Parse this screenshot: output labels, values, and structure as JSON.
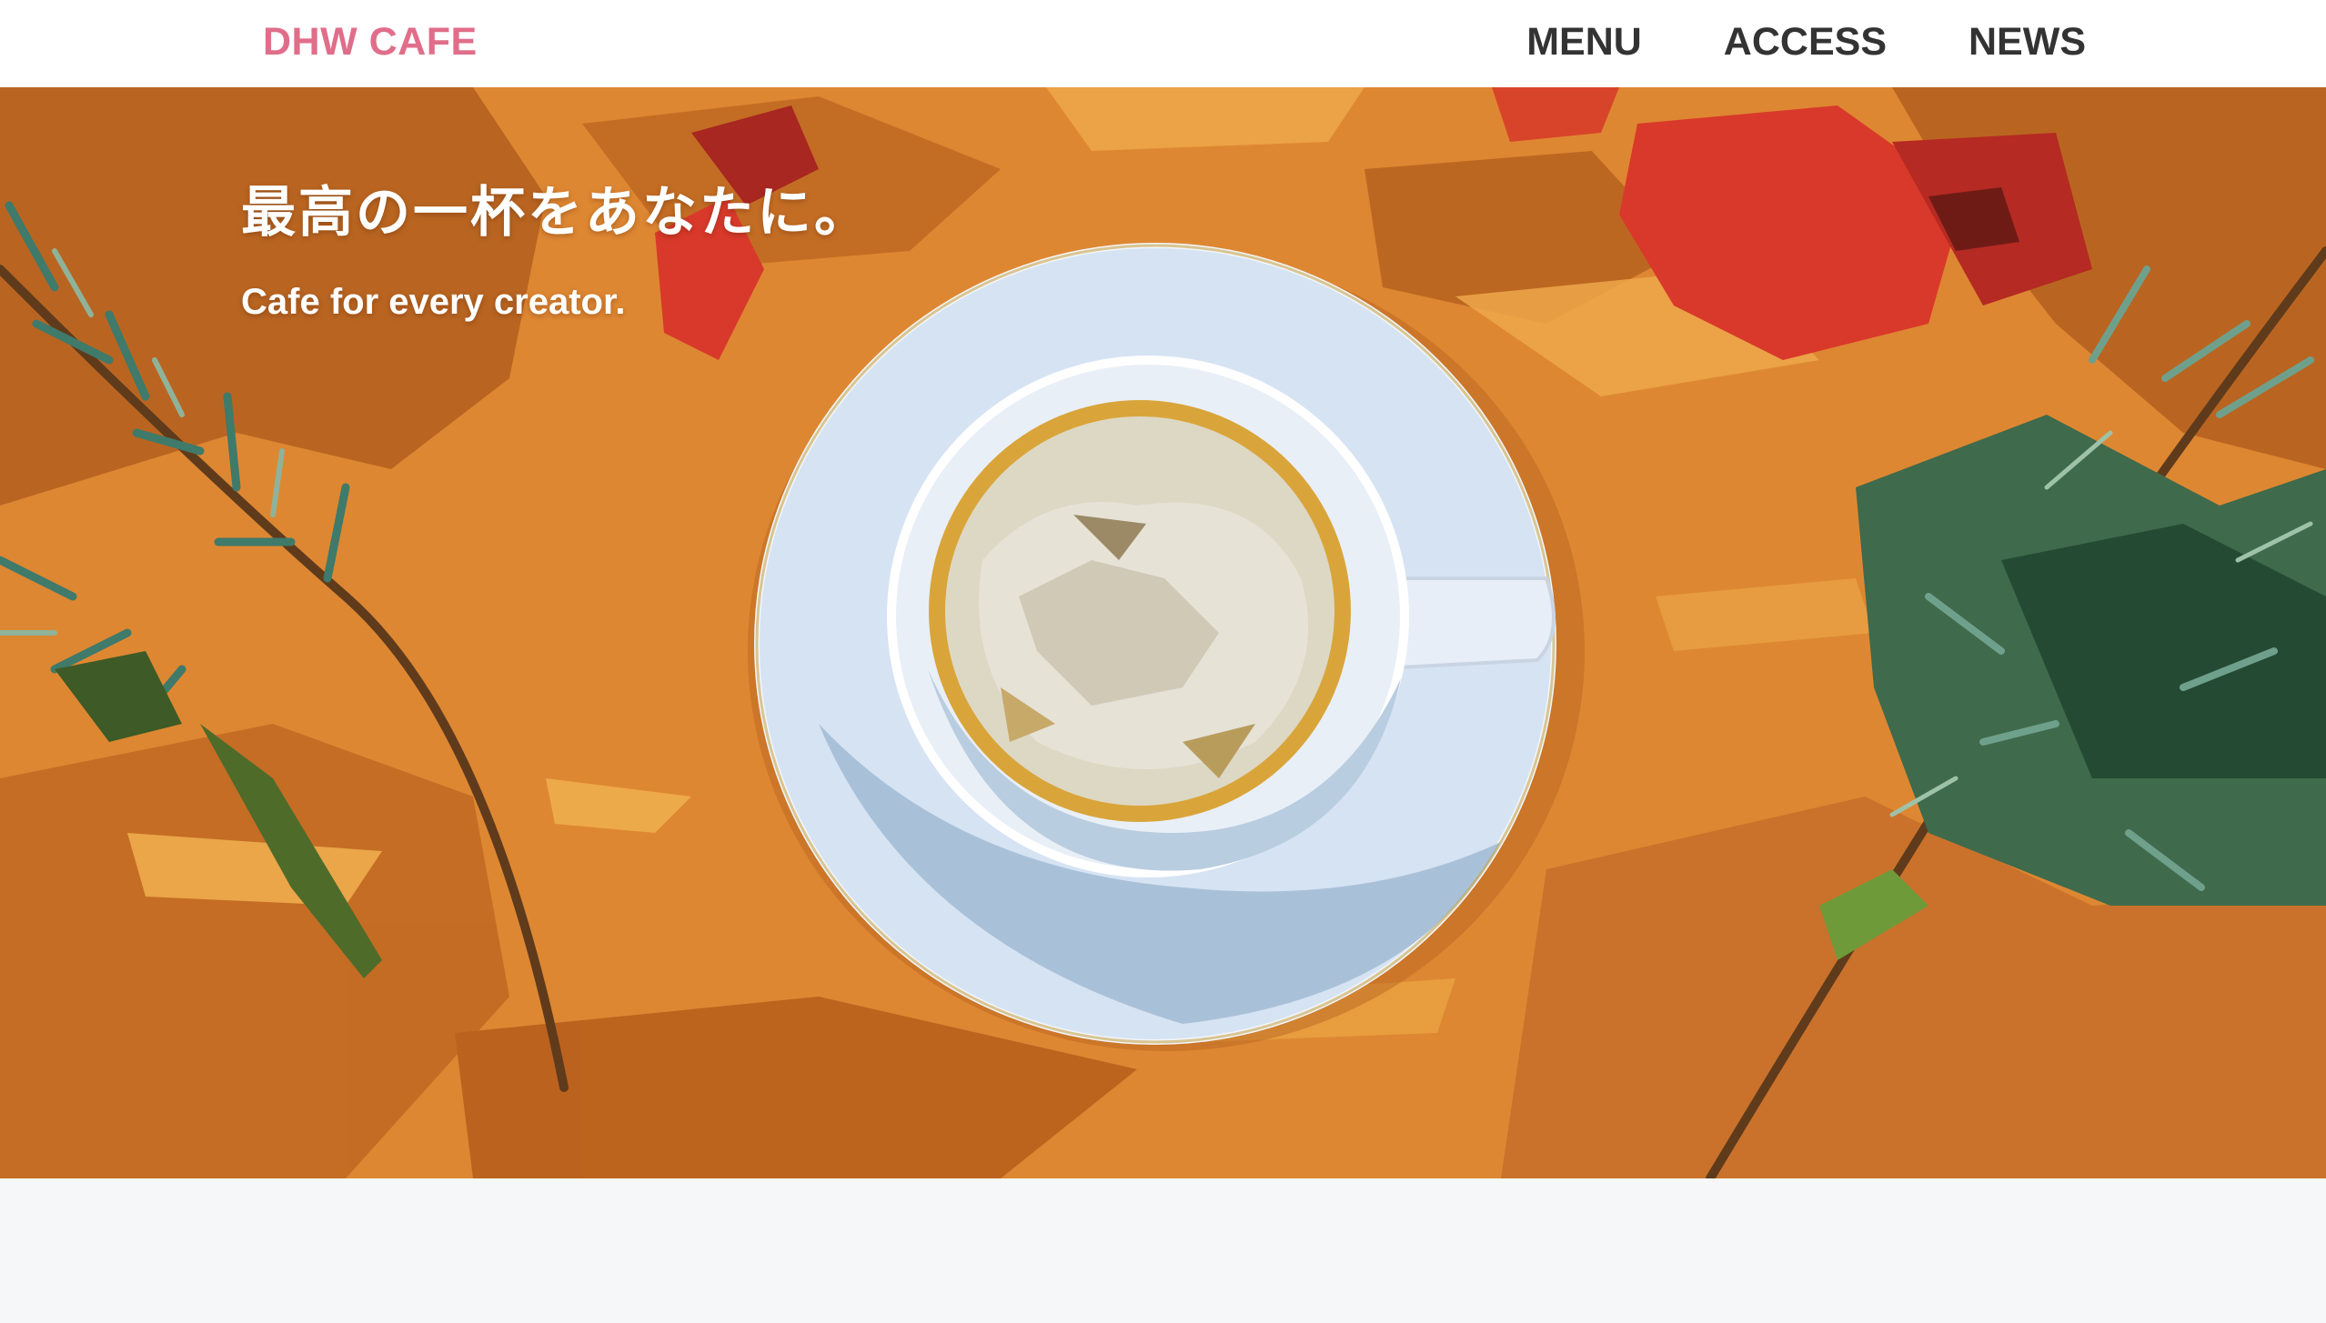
{
  "header": {
    "logo": "DHW CAFE",
    "nav": [
      {
        "label": "MENU"
      },
      {
        "label": "ACCESS"
      },
      {
        "label": "NEWS"
      }
    ]
  },
  "hero": {
    "title": "最高の一杯をあなたに。",
    "subtitle": "Cafe for every creator.",
    "image_icon": "coffee-cup-illustration"
  },
  "colors": {
    "logo": "#e06e8a",
    "nav_text": "#333333",
    "hero_background": "#de8732",
    "hero_text": "#ffffff",
    "page_background": "#f6f7f9"
  }
}
